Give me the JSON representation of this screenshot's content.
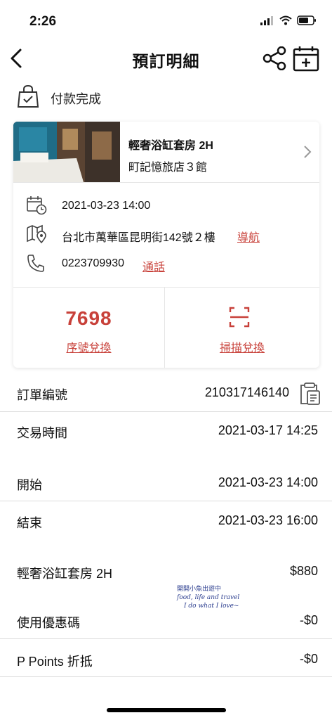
{
  "status": {
    "time": "2:26"
  },
  "nav": {
    "title": "預訂明細"
  },
  "payment": {
    "status": "付款完成"
  },
  "booking": {
    "room_name": "輕奢浴缸套房 2H",
    "hotel_name": "町記憶旅店３館",
    "datetime": "2021-03-23 14:00",
    "address": "台北市萬華區昆明街142號２樓",
    "navigate_label": "導航",
    "phone": "0223709930",
    "call_label": "通話",
    "code": "7698",
    "code_redeem_label": "序號兌換",
    "scan_redeem_label": "掃描兌換"
  },
  "details": {
    "order_number_label": "訂單編號",
    "order_number": "210317146140",
    "transaction_time_label": "交易時間",
    "transaction_time": "2021-03-17 14:25",
    "start_label": "開始",
    "start_time": "2021-03-23 14:00",
    "end_label": "結束",
    "end_time": "2021-03-23 16:00"
  },
  "pricing": {
    "item_label": "輕奢浴缸套房 2H",
    "item_price": "$880",
    "coupon_label": "使用優惠碼",
    "coupon_value": "-$0",
    "points_label": "P Points 折抵",
    "points_value": "-$0"
  },
  "watermark": {
    "line1": "開開小魚出遊中",
    "line2": "food, life and travel",
    "line3": "I do what I love~"
  },
  "colors": {
    "accent": "#c8413a"
  },
  "icons": [
    "back-icon",
    "share-icon",
    "calendar-add-icon",
    "shopping-bag-check-icon",
    "calendar-clock-icon",
    "map-pin-icon",
    "phone-icon",
    "scan-icon",
    "chevron-right-icon",
    "clipboard-icon"
  ]
}
